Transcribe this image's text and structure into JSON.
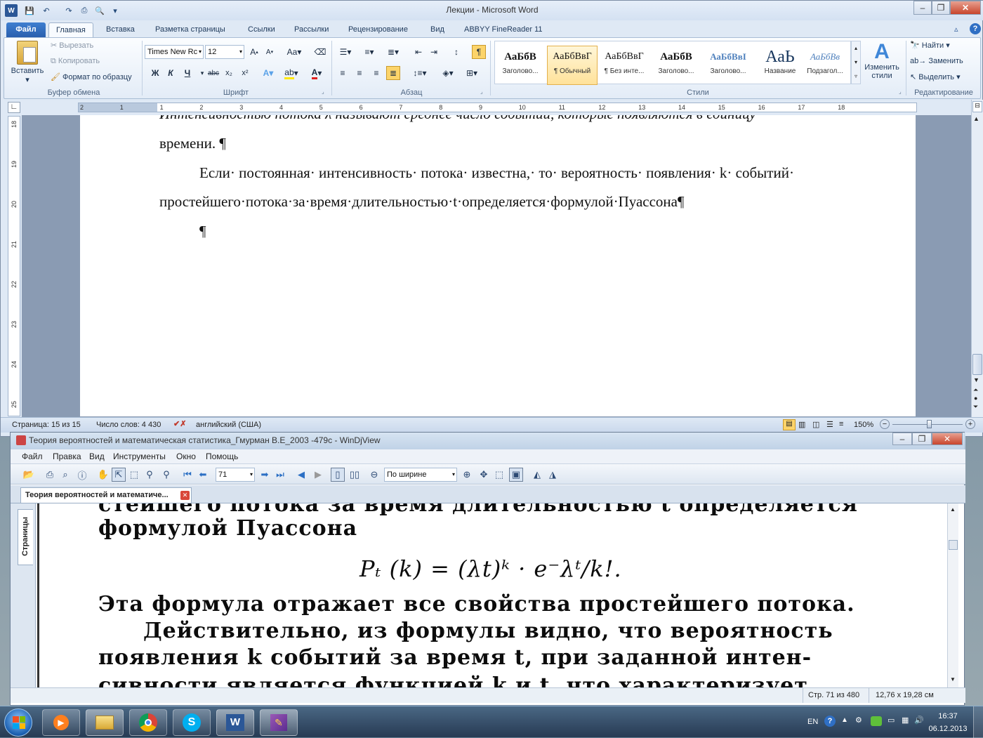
{
  "word": {
    "title": "Лекции - Microsoft Word",
    "tabs": [
      "Файл",
      "Главная",
      "Вставка",
      "Разметка страницы",
      "Ссылки",
      "Рассылки",
      "Рецензирование",
      "Вид",
      "ABBYY FineReader 11"
    ],
    "clipboard": {
      "paste": "Вставить",
      "cut": "Вырезать",
      "copy": "Копировать",
      "format_painter": "Формат по образцу",
      "label": "Буфер обмена"
    },
    "font": {
      "name": "Times New Rc",
      "size": "12",
      "label": "Шрифт"
    },
    "paragraph": {
      "label": "Абзац"
    },
    "styles": {
      "label": "Стили",
      "items": [
        {
          "preview": "АаБбВ",
          "name": "Заголово..."
        },
        {
          "preview": "АаБбВвГ",
          "name": "¶ Обычный"
        },
        {
          "preview": "АаБбВвГ",
          "name": "¶ Без инте..."
        },
        {
          "preview": "АаБбВ",
          "name": "Заголово..."
        },
        {
          "preview": "АаБбВвІ",
          "name": "Заголово..."
        },
        {
          "preview": "АаЬ",
          "name": "Название"
        },
        {
          "preview": "АаБбВв",
          "name": "Подзагол..."
        }
      ],
      "change": "Изменить стили"
    },
    "editing": {
      "find": "Найти",
      "replace": "Заменить",
      "select": "Выделить",
      "label": "Редактирование"
    },
    "ruler_numbers": [
      "2",
      "1",
      "1",
      "2",
      "3",
      "4",
      "5",
      "6",
      "7",
      "8",
      "9",
      "10",
      "11",
      "12",
      "13",
      "14",
      "15",
      "16",
      "17",
      "18"
    ],
    "vruler_numbers": [
      "18",
      "19",
      "20",
      "21",
      "22",
      "23",
      "24",
      "25"
    ],
    "doc_lines": [
      "Интенсивностью потока λ называют среднее число событий, которые появляются в единицу",
      "времени. ¶",
      "Если· постоянная· интенсивность· потока· известна,· то· вероятность· появления· k· событий·",
      "простейшего·потока·за·время·длительностью·t·определяется·формулой·Пуассона¶",
      "¶"
    ],
    "status": {
      "page": "Страница: 15 из 15",
      "words": "Число слов: 4 430",
      "lang": "английский (США)",
      "zoom": "150%"
    }
  },
  "djview": {
    "title": "Теория вероятностей и математическая статистика_Гмурман В.Е_2003 -479с - WinDjView",
    "menu": [
      "Файл",
      "Правка",
      "Вид",
      "Инструменты",
      "Окно",
      "Помощь"
    ],
    "page_value": "71",
    "zoom_mode": "По ширине",
    "tab_title": "Теория вероятностей и математиче...",
    "side_label": "Страницы",
    "scan_lines": [
      "стейшего потока за время длительностью t определяется",
      "формулой Пуассона",
      "Pₜ (k) = (λt)ᵏ · e⁻λᵗ/k!.",
      "Эта формула отражает все свойства простейшего потока.",
      "Действительно, из формулы видно, что вероятность",
      "появления k событий за время t, при заданной интен-",
      "сивности является функцией k и t, что характеризует"
    ],
    "status": {
      "page": "Стр. 71 из 480",
      "size": "12,76 x 19,28 см"
    }
  },
  "taskbar": {
    "lang": "EN",
    "time": "16:37",
    "date": "06.12.2013"
  }
}
